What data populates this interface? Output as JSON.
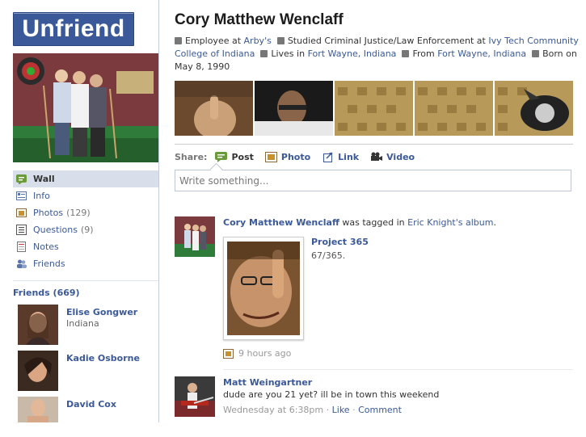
{
  "header": {
    "unfriend_label": "Unfriend",
    "name": "Cory Matthew Wenclaff"
  },
  "info": {
    "employee_prefix": "Employee at",
    "employer": "Arby's",
    "studied_prefix": "Studied Criminal Justice/Law Enforcement at",
    "school": "Ivy Tech Community College of Indiana",
    "lives_prefix": "Lives in",
    "lives_in": "Fort Wayne, Indiana",
    "from_prefix": "From",
    "from": "Fort Wayne, Indiana",
    "born_prefix": "Born on",
    "birthday": "May 8, 1990"
  },
  "nav": [
    {
      "label": "Wall",
      "icon": "wall-icon",
      "count": ""
    },
    {
      "label": "Info",
      "icon": "info-icon",
      "count": ""
    },
    {
      "label": "Photos",
      "icon": "photos-icon",
      "count": "(129)"
    },
    {
      "label": "Questions",
      "icon": "questions-icon",
      "count": "(9)"
    },
    {
      "label": "Notes",
      "icon": "notes-icon",
      "count": ""
    },
    {
      "label": "Friends",
      "icon": "friends-icon",
      "count": ""
    }
  ],
  "friends": {
    "header": "Friends (669)",
    "list": [
      {
        "name": "Elise Gongwer",
        "sub": "Indiana"
      },
      {
        "name": "Kadie Osborne",
        "sub": ""
      },
      {
        "name": "David Cox",
        "sub": ""
      }
    ]
  },
  "share": {
    "label": "Share:",
    "items": [
      "Post",
      "Photo",
      "Link",
      "Video"
    ],
    "placeholder": "Write something..."
  },
  "stories": {
    "s1": {
      "actor": "Cory Matthew Wenclaff",
      "mid": "was tagged in",
      "owner": "Eric Knight's album",
      "end": ".",
      "album_title": "Project 365",
      "album_sub": "67/365.",
      "time": "9 hours ago"
    },
    "s2": {
      "actor": "Matt Weingartner",
      "message": "dude are you 21 yet? ill be in town this weekend",
      "time": "Wednesday at 6:38pm",
      "sep": "·",
      "like": "Like",
      "comment": "Comment"
    }
  },
  "colors": {
    "brand": "#3b5998",
    "nav_active": "#d8dfea"
  }
}
